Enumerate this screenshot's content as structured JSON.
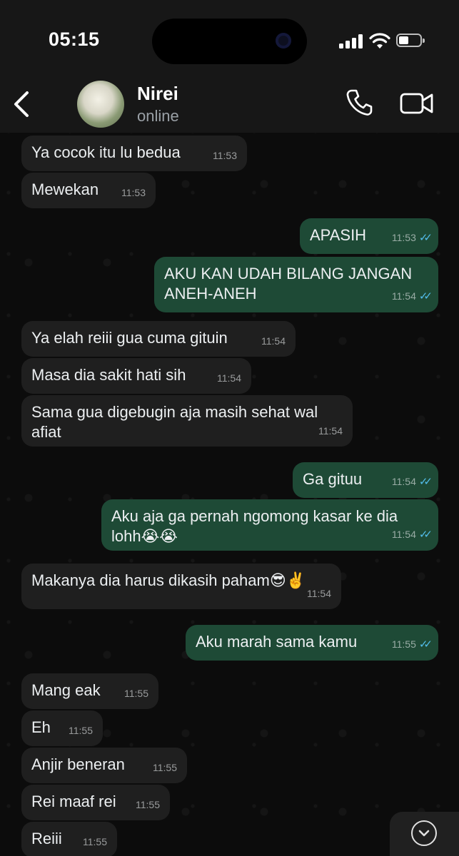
{
  "status_bar": {
    "time": "05:15"
  },
  "header": {
    "contact_name": "Nirei",
    "contact_status": "online"
  },
  "messages": [
    {
      "dir": "in",
      "text": "Ya cocok itu lu bedua",
      "time": "11:53"
    },
    {
      "dir": "in",
      "text": "Mewekan",
      "time": "11:53"
    },
    {
      "dir": "out",
      "text": "APASIH",
      "time": "11:53",
      "read": true
    },
    {
      "dir": "out",
      "text": "AKU KAN UDAH BILANG JANGAN ANEH-ANEH",
      "time": "11:54",
      "read": true
    },
    {
      "dir": "in",
      "text": "Ya elah reiii gua cuma gituin",
      "time": "11:54"
    },
    {
      "dir": "in",
      "text": "Masa dia sakit hati sih",
      "time": "11:54"
    },
    {
      "dir": "in",
      "text": "Sama gua digebugin aja masih sehat wal afiat",
      "time": "11:54"
    },
    {
      "dir": "out",
      "text": "Ga gituu",
      "time": "11:54",
      "read": true
    },
    {
      "dir": "out",
      "text": "Aku aja ga pernah ngomong kasar ke dia lohh😭😭",
      "time": "11:54",
      "read": true
    },
    {
      "dir": "in",
      "text": "Makanya dia harus dikasih paham😎✌️",
      "time": "11:54"
    },
    {
      "dir": "out",
      "text": "Aku marah sama kamu",
      "time": "11:55",
      "read": true
    },
    {
      "dir": "in",
      "text": "Mang eak",
      "time": "11:55"
    },
    {
      "dir": "in",
      "text": "Eh",
      "time": "11:55"
    },
    {
      "dir": "in",
      "text": "Anjir beneran",
      "time": "11:55"
    },
    {
      "dir": "in",
      "text": "Rei maaf rei",
      "time": "11:55"
    },
    {
      "dir": "in",
      "text": "Reiii",
      "time": "11:55"
    }
  ],
  "colors": {
    "incoming_bubble": "#1f1f1f",
    "outgoing_bubble": "#1e4a36",
    "read_ticks": "#53bdeb"
  },
  "icons": {
    "back": "chevron-left-icon",
    "call": "phone-icon",
    "video": "video-camera-icon",
    "scroll_down": "chevron-down-icon"
  }
}
